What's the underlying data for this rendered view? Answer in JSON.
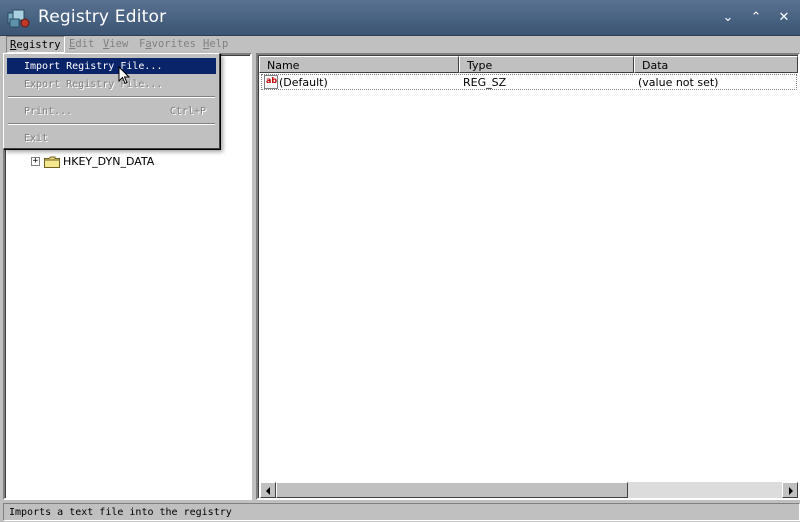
{
  "window": {
    "title": "Registry Editor",
    "buttons": [
      "minimize-icon",
      "maximize-icon",
      "close-icon"
    ]
  },
  "menubar": {
    "items": [
      {
        "label": "Registry",
        "mnemonic": "R"
      },
      {
        "label": "Edit",
        "mnemonic": "E"
      },
      {
        "label": "View",
        "mnemonic": "V"
      },
      {
        "label": "Favorites",
        "mnemonic": "a"
      },
      {
        "label": "Help",
        "mnemonic": "H"
      }
    ]
  },
  "dropdown": {
    "import": "Import Registry File...",
    "export": "Export Registry File...",
    "print": "Print...",
    "print_shortcut": "Ctrl+P",
    "exit": "Exit"
  },
  "tree": {
    "node_label": "HKEY_DYN_DATA",
    "expander": "+"
  },
  "list": {
    "columns": [
      "Name",
      "Type",
      "Data"
    ],
    "rows": [
      {
        "name": "(Default)",
        "type": "REG_SZ",
        "data": "(value not set)",
        "icon": "string-value-icon"
      }
    ]
  },
  "status": {
    "text": "Imports a text file into the registry"
  },
  "colors": {
    "titlebar": "#46607f",
    "highlight": "#0a246a",
    "face": "#c0c0c0"
  }
}
